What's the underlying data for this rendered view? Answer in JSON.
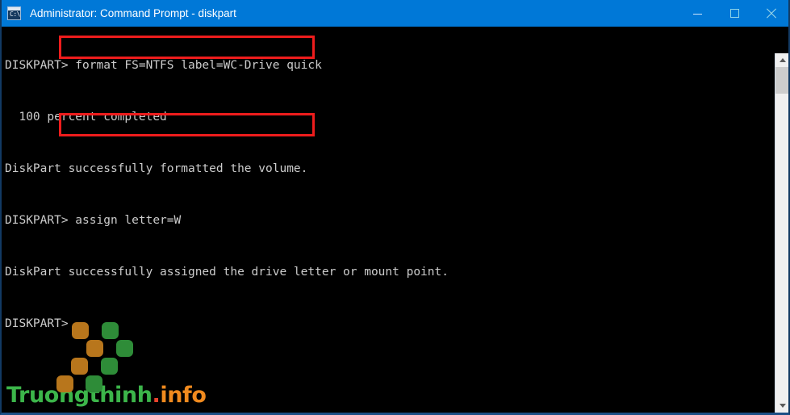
{
  "window": {
    "title": "Administrator: Command Prompt - diskpart",
    "icon": "console-icon",
    "icon_text": "C:\\",
    "titlebar_color": "#0078d7",
    "background_color": "#000000",
    "text_color": "#cccccc"
  },
  "controls": {
    "minimize_label": "Minimize",
    "maximize_label": "Maximize",
    "close_label": "Close"
  },
  "console": {
    "lines": [
      "DISKPART> format FS=NTFS label=WC-Drive quick",
      "",
      "  100 percent completed",
      "",
      "DiskPart successfully formatted the volume.",
      "",
      "DISKPART> assign letter=W",
      "",
      "DiskPart successfully assigned the drive letter or mount point.",
      "",
      "DISKPART>"
    ],
    "highlights": [
      {
        "name": "format-command-highlight",
        "text": "format FS=NTFS label=WC-Drive quick",
        "color": "#ee1c1c"
      },
      {
        "name": "assign-command-highlight",
        "text": "assign letter=W",
        "color": "#ee1c1c"
      }
    ]
  },
  "watermark": {
    "name_part": "Truongthinh",
    "dot": ".",
    "tld": "info",
    "green": "#3cb54a",
    "orange": "#f08a1e",
    "dot_color": "#e8432c",
    "logo_orange": "#b8761c",
    "logo_green": "#2e8c38"
  },
  "scrollbar": {
    "up_arrow": "scroll-up",
    "down_arrow": "scroll-down",
    "thumb": "scroll-thumb"
  }
}
